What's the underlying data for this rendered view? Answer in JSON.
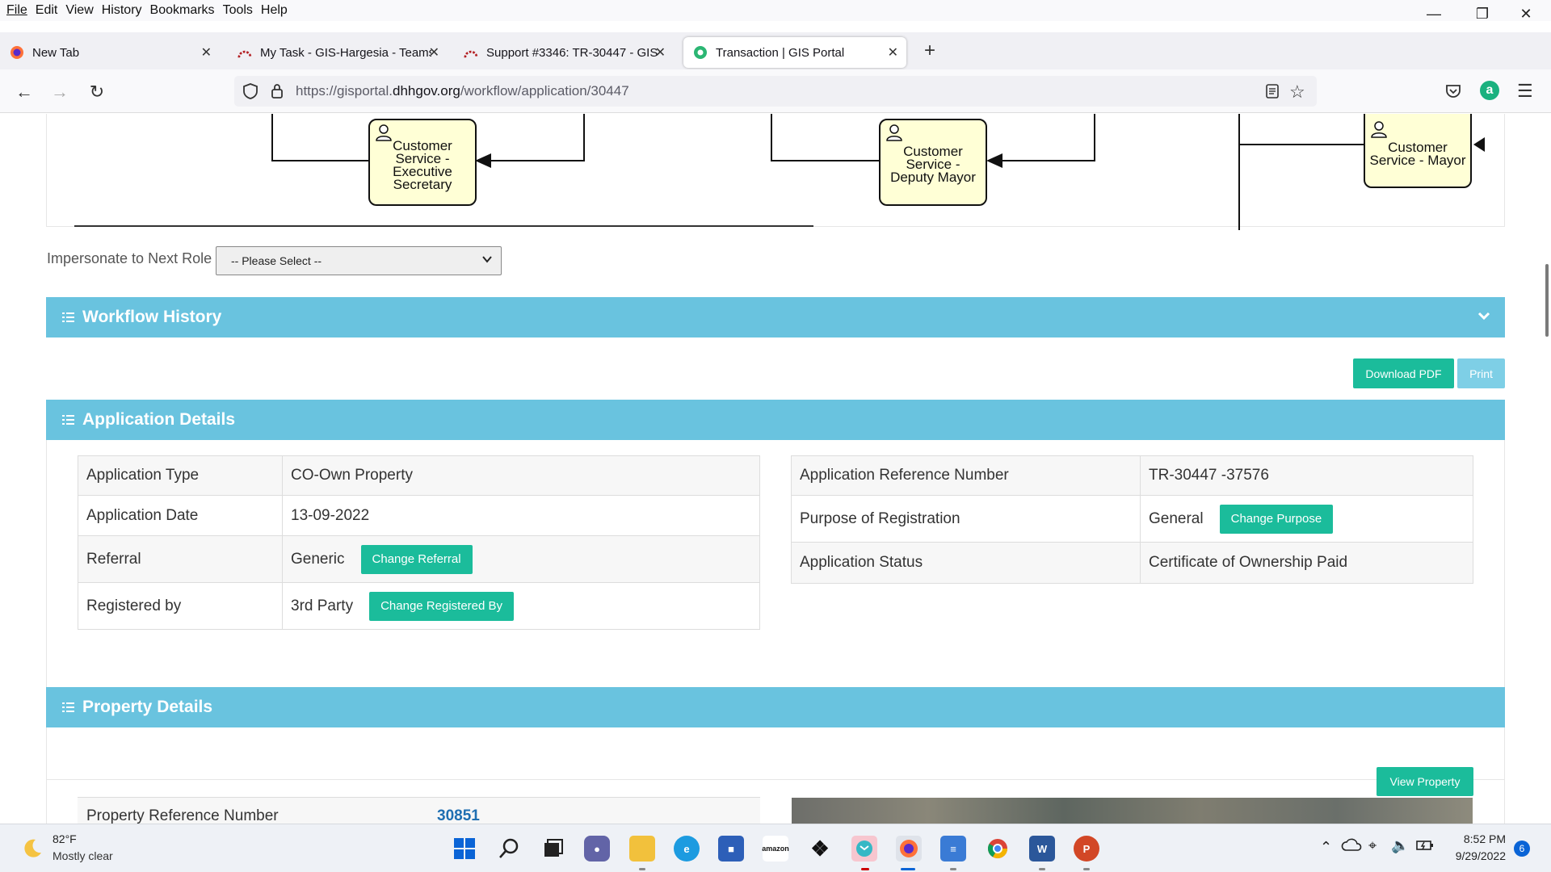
{
  "browser": {
    "menu": [
      "File",
      "Edit",
      "View",
      "History",
      "Bookmarks",
      "Tools",
      "Help"
    ],
    "tabs": [
      {
        "title": "New Tab",
        "active": false
      },
      {
        "title": "My Task - GIS-Hargesia - Teams",
        "active": false
      },
      {
        "title": "Support #3346: TR-30447 - GIS",
        "active": false
      },
      {
        "title": "Transaction | GIS Portal",
        "active": true
      }
    ],
    "url_prefix": "https://gisportal.",
    "url_domain": "dhhgov.org",
    "url_path": "/workflow/application/30447"
  },
  "workflow_diagram": {
    "nodes": [
      {
        "label_lines": [
          "Customer",
          "Service -",
          "Executive",
          "Secretary"
        ]
      },
      {
        "label_lines": [
          "Customer",
          "Service -",
          "Deputy Mayor"
        ]
      },
      {
        "label_lines": [
          "Customer",
          "Service - Mayor"
        ]
      }
    ]
  },
  "impersonate": {
    "label": "Impersonate to Next Role",
    "selected": "-- Please Select --"
  },
  "workflow_history": {
    "title": "Workflow History"
  },
  "actions": {
    "download_pdf": "Download PDF",
    "print": "Print"
  },
  "application_details": {
    "title": "Application Details",
    "left_rows": [
      {
        "label": "Application Type",
        "value": "CO-Own Property"
      },
      {
        "label": "Application Date",
        "value": "13-09-2022"
      },
      {
        "label": "Referral",
        "value": "Generic",
        "button": "Change Referral"
      },
      {
        "label": "Registered by",
        "value": "3rd Party",
        "button": "Change Registered By"
      }
    ],
    "right_rows": [
      {
        "label": "Application Reference Number",
        "value": "TR-30447 -37576"
      },
      {
        "label": "Purpose of Registration",
        "value": "General",
        "button": "Change Purpose"
      },
      {
        "label": "Application Status",
        "value": "Certificate of Ownership Paid"
      }
    ]
  },
  "property_details": {
    "title": "Property Details",
    "view_property": "View Property",
    "ref_label": "Property Reference Number",
    "ref_value": "30851"
  },
  "taskbar": {
    "weather_temp": "82°F",
    "weather_desc": "Mostly clear",
    "time": "8:52 PM",
    "date": "9/29/2022",
    "notification_count": "6"
  },
  "colors": {
    "panel_header": "#69c3df",
    "button_green": "#1bbc9b",
    "button_print": "#7ecfe6",
    "link_blue": "#1f6fb2"
  }
}
